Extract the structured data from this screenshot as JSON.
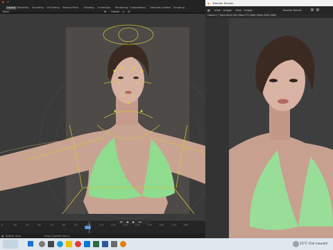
{
  "workspace_tabs": [
    "Layout",
    "Modeling",
    "Sculpting",
    "UV Editing",
    "Texture Paint",
    "Shading",
    "Animation",
    "Rendering",
    "Compositing",
    "Geometry Nodes",
    "Scripting"
  ],
  "header": {
    "mode_label": "Pose",
    "orientation": "Global"
  },
  "timeline": {
    "ticks": [
      "0",
      "40",
      "50",
      "60",
      "70",
      "80",
      "90",
      "100",
      "110",
      "120",
      "130",
      "140",
      "150",
      "160",
      "170",
      "180"
    ],
    "current_frame": "110"
  },
  "status": {
    "left": "Rotate View",
    "middle": "Pose Context Menu"
  },
  "render_window": {
    "title": "Blender Render",
    "menu": {
      "view": "View",
      "image_menu": "Image",
      "view2": "View",
      "image2": "Image",
      "slot": "Render Result"
    },
    "info": "Frame:1 | Time:00:00.98 | Mem:771.96M (Peak 2350.34M)"
  },
  "taskbar": {
    "weather_temp": "15°C",
    "weather_text": "Ciel couvert"
  },
  "colors": {
    "accent": "#4d7fc4",
    "bikini": "#8fdc8f",
    "rig": "#d4c23a"
  }
}
